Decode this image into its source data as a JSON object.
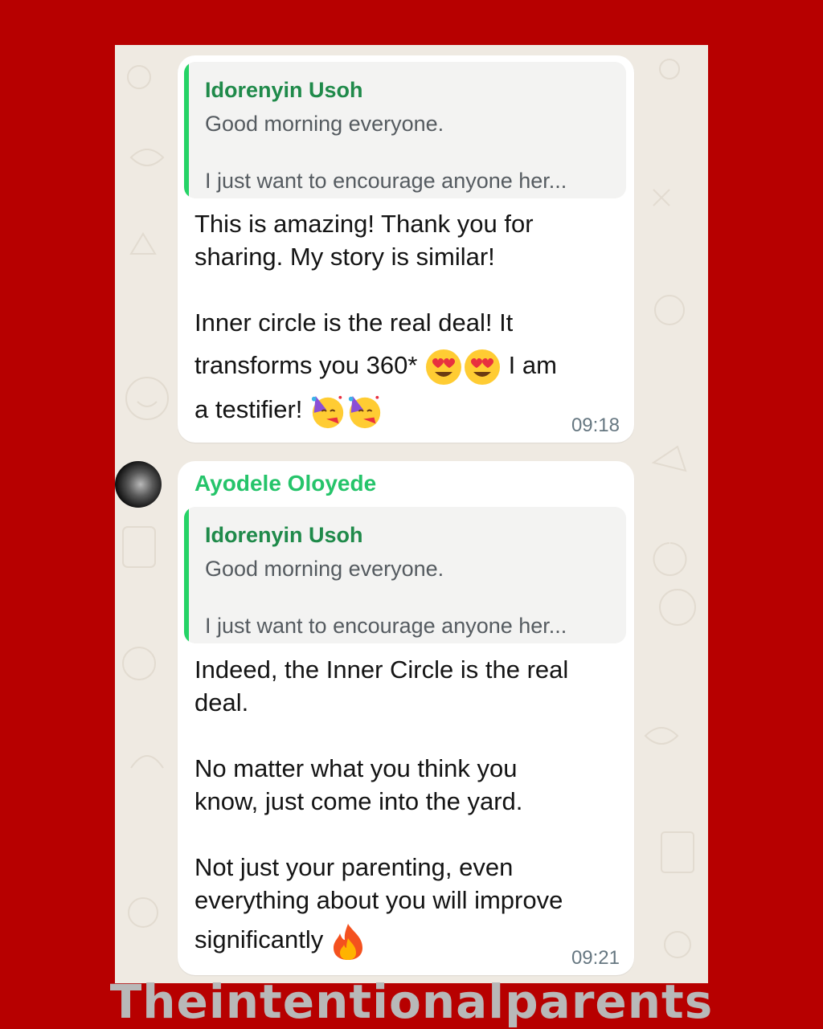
{
  "background_color": "#b70000",
  "messages": [
    {
      "quote": {
        "author": "Idorenyin Usoh",
        "line1": "Good morning everyone.",
        "line2": "I just want to encourage anyone her..."
      },
      "lines": [
        "This is amazing! Thank you for",
        "sharing. My story is similar!",
        "Inner circle is the real deal! It",
        "transforms you 360*",
        "I am",
        "a testifier!"
      ],
      "emojis": [
        "heart-eyes-emoji",
        "heart-eyes-emoji",
        "partying-face-emoji",
        "partying-face-emoji"
      ],
      "time": "09:18"
    },
    {
      "sender": "Ayodele Oloyede",
      "quote": {
        "author": "Idorenyin Usoh",
        "line1": "Good morning everyone.",
        "line2": "I just want to encourage anyone her..."
      },
      "lines": [
        "Indeed, the Inner Circle is the real",
        "deal.",
        "No matter what you think you",
        "know, just come into the yard.",
        "Not just your parenting, even",
        "everything about you will improve",
        "significantly"
      ],
      "emojis": [
        "fire-emoji"
      ],
      "time": "09:21"
    }
  ],
  "watermark": "Theintentionalparents",
  "colors": {
    "sender_name": "#25c46a",
    "quote_author": "#1f8a4a",
    "quote_bar": "#25d366"
  }
}
